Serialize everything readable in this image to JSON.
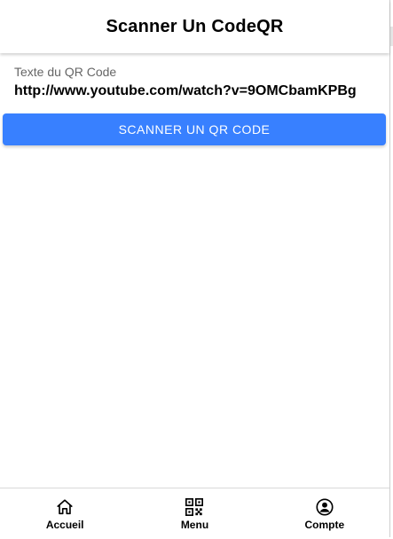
{
  "header": {
    "title": "Scanner Un CodeQR"
  },
  "main": {
    "field_label": "Texte du QR Code",
    "field_value": "http://www.youtube.com/watch?v=9OMCbamKPBg",
    "scan_button_label": "SCANNER UN QR CODE"
  },
  "tabs": [
    {
      "label": "Accueil",
      "icon": "home-icon"
    },
    {
      "label": "Menu",
      "icon": "qr-code-icon"
    },
    {
      "label": "Compte",
      "icon": "person-circle-icon"
    }
  ],
  "colors": {
    "primary": "#3880ff",
    "text": "#000000",
    "muted": "#666666"
  }
}
